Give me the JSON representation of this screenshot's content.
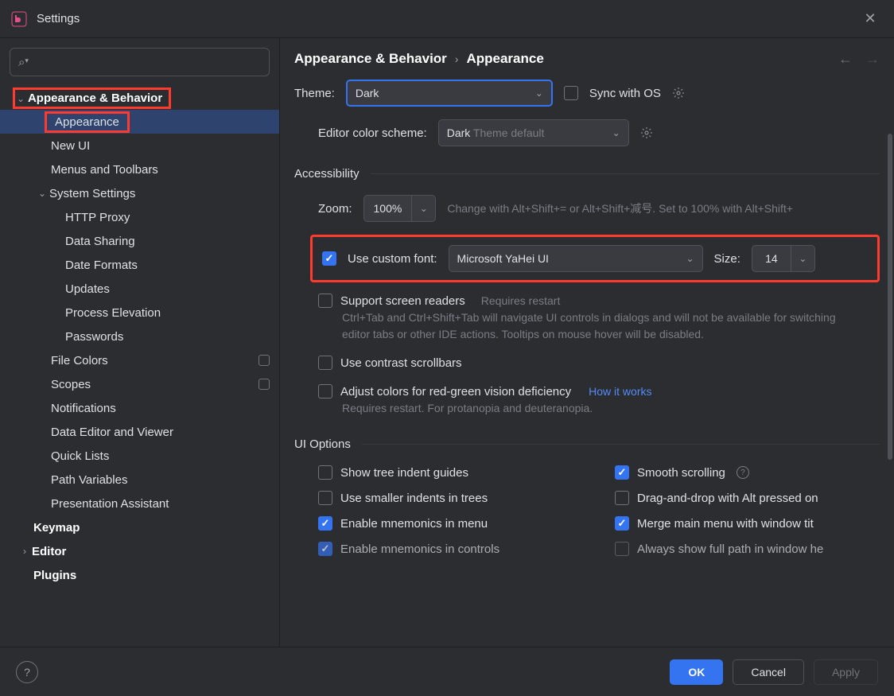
{
  "window": {
    "title": "Settings"
  },
  "breadcrumb": {
    "parent": "Appearance & Behavior",
    "current": "Appearance"
  },
  "sidebar": {
    "category": "Appearance & Behavior",
    "items": [
      {
        "label": "Appearance"
      },
      {
        "label": "New UI"
      },
      {
        "label": "Menus and Toolbars"
      },
      {
        "label": "System Settings"
      },
      {
        "label": "HTTP Proxy"
      },
      {
        "label": "Data Sharing"
      },
      {
        "label": "Date Formats"
      },
      {
        "label": "Updates"
      },
      {
        "label": "Process Elevation"
      },
      {
        "label": "Passwords"
      },
      {
        "label": "File Colors"
      },
      {
        "label": "Scopes"
      },
      {
        "label": "Notifications"
      },
      {
        "label": "Data Editor and Viewer"
      },
      {
        "label": "Quick Lists"
      },
      {
        "label": "Path Variables"
      },
      {
        "label": "Presentation Assistant"
      }
    ],
    "bottom": [
      {
        "label": "Keymap"
      },
      {
        "label": "Editor"
      },
      {
        "label": "Plugins"
      }
    ]
  },
  "theme": {
    "label": "Theme:",
    "value": "Dark",
    "sync_label": "Sync with OS",
    "scheme_label": "Editor color scheme:",
    "scheme_value": "Dark",
    "scheme_suffix": " Theme default"
  },
  "accessibility": {
    "title": "Accessibility",
    "zoom_label": "Zoom:",
    "zoom_value": "100%",
    "zoom_hint": "Change with Alt+Shift+= or Alt+Shift+减号. Set to 100% with Alt+Shift+",
    "custom_font_label": "Use custom font:",
    "custom_font_value": "Microsoft YaHei UI",
    "size_label": "Size:",
    "size_value": "14",
    "screen_readers_label": "Support screen readers",
    "screen_readers_hint": "Requires restart",
    "screen_readers_desc": "Ctrl+Tab and Ctrl+Shift+Tab will navigate UI controls in dialogs and will not be available for switching editor tabs or other IDE actions. Tooltips on mouse hover will be disabled.",
    "contrast_label": "Use contrast scrollbars",
    "color_def_label": "Adjust colors for red-green vision deficiency",
    "color_def_link": "How it works",
    "color_def_desc": "Requires restart. For protanopia and deuteranopia."
  },
  "ui_options": {
    "title": "UI Options",
    "left": [
      {
        "label": "Show tree indent guides",
        "checked": false
      },
      {
        "label": "Use smaller indents in trees",
        "checked": false
      },
      {
        "label": "Enable mnemonics in menu",
        "checked": true
      },
      {
        "label": "Enable mnemonics in controls",
        "checked": true
      }
    ],
    "right": [
      {
        "label": "Smooth scrolling",
        "checked": true,
        "info": true
      },
      {
        "label": "Drag-and-drop with Alt pressed on",
        "checked": false
      },
      {
        "label": "Merge main menu with window tit",
        "checked": true
      },
      {
        "label": "Always show full path in window he",
        "checked": false
      }
    ]
  },
  "footer": {
    "ok": "OK",
    "cancel": "Cancel",
    "apply": "Apply"
  }
}
